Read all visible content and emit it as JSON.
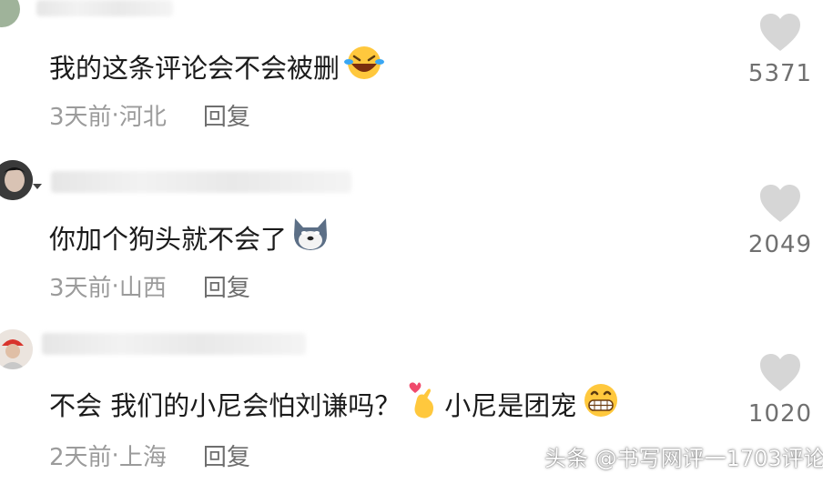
{
  "comments": [
    {
      "text": "我的这条评论会不会被删",
      "emoji": "laughing-tears",
      "date": "3天前",
      "location": "河北",
      "reply_label": "回复",
      "likes": "5371"
    },
    {
      "text": "你加个狗头就不会了",
      "emoji": "dog-head",
      "date": "3天前",
      "location": "山西",
      "reply_label": "回复",
      "likes": "2049"
    },
    {
      "text_part1": "不会 我们的小尼会怕刘谦吗？",
      "emoji_mid": "finger-heart",
      "text_part2": "小尼是团宠",
      "emoji": "grin",
      "date": "2天前",
      "location": "上海",
      "reply_label": "回复",
      "likes": "1020"
    }
  ],
  "separator": " · ",
  "watermark": "头条 @书写网评一1703评论",
  "colors": {
    "text": "#1b1b1b",
    "meta": "#9b9b9b",
    "heart": "#d6d6d6"
  }
}
